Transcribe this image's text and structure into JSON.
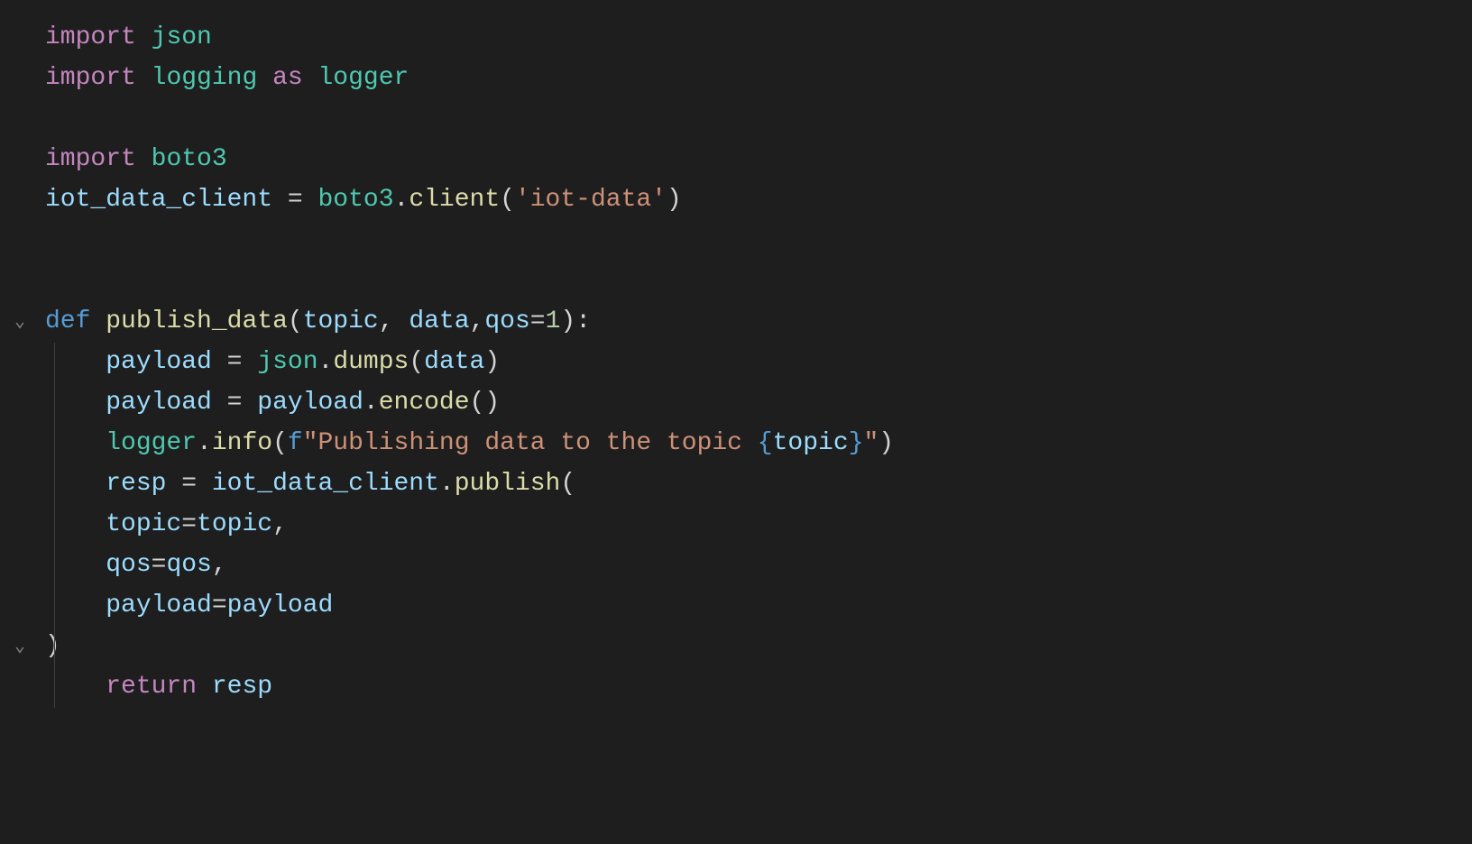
{
  "code": {
    "lines": [
      {
        "indent": 0,
        "fold": null,
        "tokens": [
          {
            "cls": "tok-keyword",
            "text": "import"
          },
          {
            "cls": "tok-text",
            "text": " "
          },
          {
            "cls": "tok-module",
            "text": "json"
          }
        ]
      },
      {
        "indent": 0,
        "fold": null,
        "tokens": [
          {
            "cls": "tok-keyword",
            "text": "import"
          },
          {
            "cls": "tok-text",
            "text": " "
          },
          {
            "cls": "tok-module",
            "text": "logging"
          },
          {
            "cls": "tok-text",
            "text": " "
          },
          {
            "cls": "tok-keyword",
            "text": "as"
          },
          {
            "cls": "tok-text",
            "text": " "
          },
          {
            "cls": "tok-module",
            "text": "logger"
          }
        ]
      },
      {
        "indent": 0,
        "fold": null,
        "cursor": true,
        "tokens": []
      },
      {
        "indent": 0,
        "fold": null,
        "tokens": [
          {
            "cls": "tok-keyword",
            "text": "import"
          },
          {
            "cls": "tok-text",
            "text": " "
          },
          {
            "cls": "tok-module",
            "text": "boto3"
          }
        ]
      },
      {
        "indent": 0,
        "fold": null,
        "tokens": [
          {
            "cls": "tok-variable",
            "text": "iot_data_client"
          },
          {
            "cls": "tok-text",
            "text": " "
          },
          {
            "cls": "tok-operator",
            "text": "="
          },
          {
            "cls": "tok-text",
            "text": " "
          },
          {
            "cls": "tok-module",
            "text": "boto3"
          },
          {
            "cls": "tok-punct",
            "text": "."
          },
          {
            "cls": "tok-method",
            "text": "client"
          },
          {
            "cls": "tok-punct",
            "text": "("
          },
          {
            "cls": "tok-string",
            "text": "'iot-data'"
          },
          {
            "cls": "tok-punct",
            "text": ")"
          }
        ]
      },
      {
        "indent": 0,
        "fold": null,
        "tokens": []
      },
      {
        "indent": 0,
        "fold": null,
        "tokens": []
      },
      {
        "indent": 0,
        "fold": "open",
        "tokens": [
          {
            "cls": "tok-def",
            "text": "def"
          },
          {
            "cls": "tok-text",
            "text": " "
          },
          {
            "cls": "tok-funcname",
            "text": "publish_data"
          },
          {
            "cls": "tok-punct",
            "text": "("
          },
          {
            "cls": "tok-param",
            "text": "topic"
          },
          {
            "cls": "tok-punct",
            "text": ", "
          },
          {
            "cls": "tok-param",
            "text": "data"
          },
          {
            "cls": "tok-punct",
            "text": ","
          },
          {
            "cls": "tok-param",
            "text": "qos"
          },
          {
            "cls": "tok-operator",
            "text": "="
          },
          {
            "cls": "tok-number",
            "text": "1"
          },
          {
            "cls": "tok-punct",
            "text": "):"
          }
        ]
      },
      {
        "indent": 1,
        "fold": null,
        "guide": true,
        "tokens": [
          {
            "cls": "tok-variable",
            "text": "payload"
          },
          {
            "cls": "tok-text",
            "text": " "
          },
          {
            "cls": "tok-operator",
            "text": "="
          },
          {
            "cls": "tok-text",
            "text": " "
          },
          {
            "cls": "tok-module",
            "text": "json"
          },
          {
            "cls": "tok-punct",
            "text": "."
          },
          {
            "cls": "tok-method",
            "text": "dumps"
          },
          {
            "cls": "tok-punct",
            "text": "("
          },
          {
            "cls": "tok-variable",
            "text": "data"
          },
          {
            "cls": "tok-punct",
            "text": ")"
          }
        ]
      },
      {
        "indent": 1,
        "fold": null,
        "guide": true,
        "tokens": [
          {
            "cls": "tok-variable",
            "text": "payload"
          },
          {
            "cls": "tok-text",
            "text": " "
          },
          {
            "cls": "tok-operator",
            "text": "="
          },
          {
            "cls": "tok-text",
            "text": " "
          },
          {
            "cls": "tok-variable",
            "text": "payload"
          },
          {
            "cls": "tok-punct",
            "text": "."
          },
          {
            "cls": "tok-method",
            "text": "encode"
          },
          {
            "cls": "tok-punct",
            "text": "()"
          }
        ]
      },
      {
        "indent": 1,
        "fold": null,
        "guide": true,
        "tokens": [
          {
            "cls": "tok-module",
            "text": "logger"
          },
          {
            "cls": "tok-punct",
            "text": "."
          },
          {
            "cls": "tok-method",
            "text": "info"
          },
          {
            "cls": "tok-punct",
            "text": "("
          },
          {
            "cls": "tok-def",
            "text": "f"
          },
          {
            "cls": "tok-string",
            "text": "\"Publishing data to the topic "
          },
          {
            "cls": "tok-brace",
            "text": "{"
          },
          {
            "cls": "tok-variable",
            "text": "topic"
          },
          {
            "cls": "tok-brace",
            "text": "}"
          },
          {
            "cls": "tok-string",
            "text": "\""
          },
          {
            "cls": "tok-punct",
            "text": ")"
          }
        ]
      },
      {
        "indent": 1,
        "fold": null,
        "guide": true,
        "tokens": [
          {
            "cls": "tok-variable",
            "text": "resp"
          },
          {
            "cls": "tok-text",
            "text": " "
          },
          {
            "cls": "tok-operator",
            "text": "="
          },
          {
            "cls": "tok-text",
            "text": " "
          },
          {
            "cls": "tok-variable",
            "text": "iot_data_client"
          },
          {
            "cls": "tok-punct",
            "text": "."
          },
          {
            "cls": "tok-method",
            "text": "publish"
          },
          {
            "cls": "tok-punct",
            "text": "("
          }
        ]
      },
      {
        "indent": 1,
        "fold": null,
        "guide": true,
        "tokens": [
          {
            "cls": "tok-param",
            "text": "topic"
          },
          {
            "cls": "tok-operator",
            "text": "="
          },
          {
            "cls": "tok-variable",
            "text": "topic"
          },
          {
            "cls": "tok-punct",
            "text": ","
          }
        ]
      },
      {
        "indent": 1,
        "fold": null,
        "guide": true,
        "tokens": [
          {
            "cls": "tok-param",
            "text": "qos"
          },
          {
            "cls": "tok-operator",
            "text": "="
          },
          {
            "cls": "tok-variable",
            "text": "qos"
          },
          {
            "cls": "tok-punct",
            "text": ","
          }
        ]
      },
      {
        "indent": 1,
        "fold": null,
        "guide": true,
        "tokens": [
          {
            "cls": "tok-param",
            "text": "payload"
          },
          {
            "cls": "tok-operator",
            "text": "="
          },
          {
            "cls": "tok-variable",
            "text": "payload"
          }
        ]
      },
      {
        "indent": 0,
        "fold": "open",
        "guide": true,
        "tokens": [
          {
            "cls": "tok-punct",
            "text": ")"
          }
        ]
      },
      {
        "indent": 1,
        "fold": null,
        "guide": true,
        "tokens": [
          {
            "cls": "tok-keyword",
            "text": "return"
          },
          {
            "cls": "tok-text",
            "text": " "
          },
          {
            "cls": "tok-variable",
            "text": "resp"
          }
        ]
      }
    ]
  },
  "foldGlyph": "⌄"
}
